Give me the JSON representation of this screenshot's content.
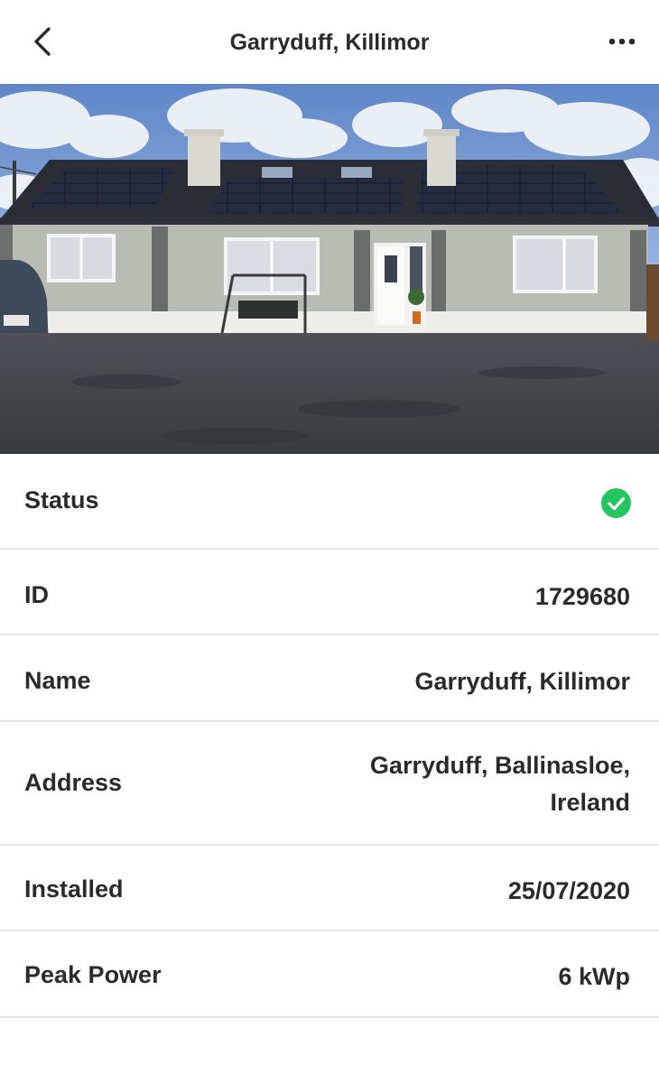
{
  "header": {
    "title": "Garryduff, Killimor",
    "back_icon": "chevron-left-icon",
    "more_icon": "more-horizontal-icon"
  },
  "photo": {
    "description_icon": "house-photo"
  },
  "details": {
    "status": {
      "label": "Status",
      "icon": "check-circle-icon",
      "color": "#22c55e"
    },
    "id": {
      "label": "ID",
      "value": "1729680"
    },
    "name": {
      "label": "Name",
      "value": "Garryduff, Killimor"
    },
    "address": {
      "label": "Address",
      "line1": "Garryduff, Ballinasloe,",
      "line2": "Ireland"
    },
    "installed": {
      "label": "Installed",
      "value": "25/07/2020"
    },
    "peak_power": {
      "label": "Peak Power",
      "value": "6 kWp"
    }
  }
}
